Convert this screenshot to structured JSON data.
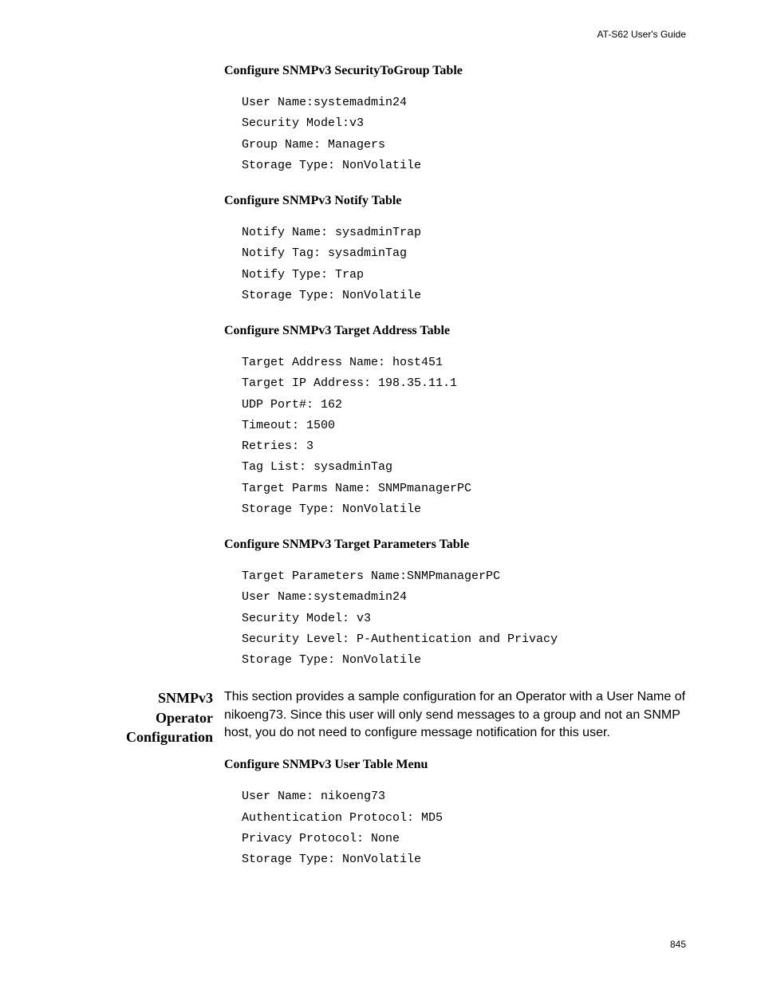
{
  "header": "AT-S62 User's Guide",
  "pageNumber": "845",
  "sections": {
    "s1": {
      "heading": "Configure SNMPv3 SecurityToGroup Table",
      "lines": "User Name:systemadmin24\nSecurity Model:v3\nGroup Name: Managers\nStorage Type: NonVolatile"
    },
    "s2": {
      "heading": "Configure SNMPv3 Notify Table",
      "lines": "Notify Name: sysadminTrap\nNotify Tag: sysadminTag\nNotify Type: Trap\nStorage Type: NonVolatile"
    },
    "s3": {
      "heading": "Configure SNMPv3 Target Address Table",
      "lines": "Target Address Name: host451\nTarget IP Address: 198.35.11.1\nUDP Port#: 162\nTimeout: 1500\nRetries: 3\nTag List: sysadminTag\nTarget Parms Name: SNMPmanagerPC\nStorage Type: NonVolatile"
    },
    "s4": {
      "heading": "Configure SNMPv3 Target Parameters Table",
      "lines": "Target Parameters Name:SNMPmanagerPC\nUser Name:systemadmin24\nSecurity Model: v3\nSecurity Level: P-Authentication and Privacy\nStorage Type: NonVolatile"
    },
    "operator": {
      "sideHeading": "SNMPv3 Operator Configuration",
      "body": "This section provides a sample configuration for an Operator with a User Name of nikoeng73. Since this user will only send messages to a group and not an SNMP host, you do not need to configure message notification for this user."
    },
    "s5": {
      "heading": "Configure SNMPv3 User Table Menu",
      "lines": "User Name: nikoeng73\nAuthentication Protocol: MD5\nPrivacy Protocol: None\nStorage Type: NonVolatile"
    }
  }
}
